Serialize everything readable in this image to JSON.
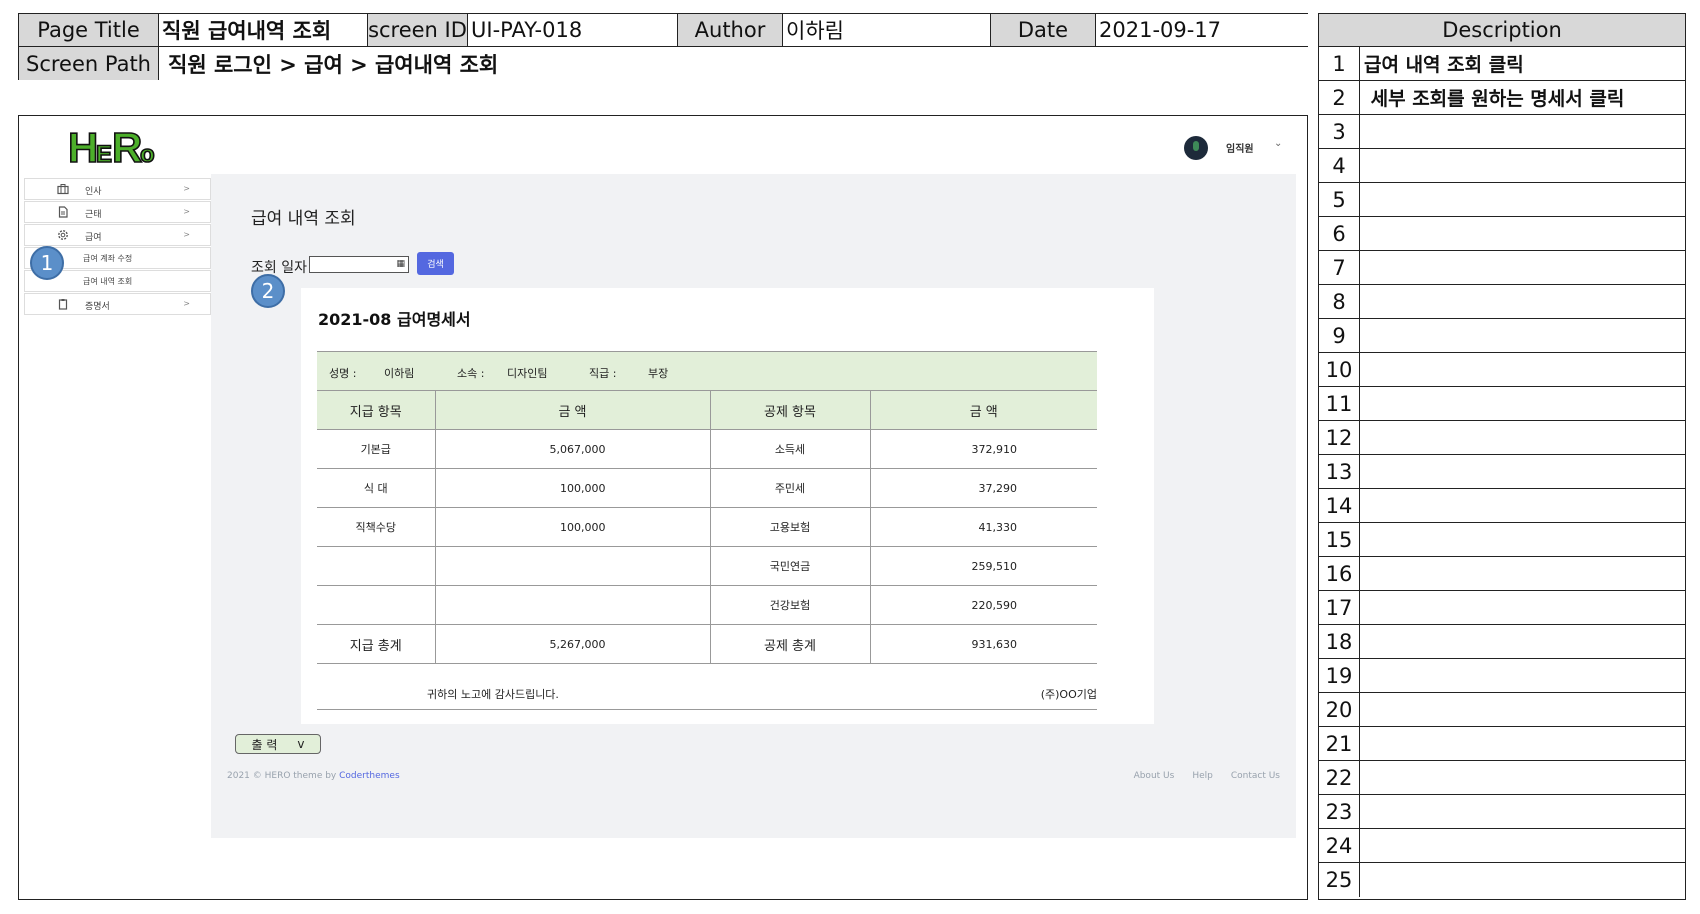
{
  "header": {
    "page_title_label": "Page Title",
    "page_title": "직원 급여내역 조회",
    "screen_id_label": "screen ID",
    "screen_id": "UI-PAY-018",
    "author_label": "Author",
    "author": "이하림",
    "date_label": "Date",
    "date": "2021-09-17",
    "screen_path_label": "Screen Path",
    "screen_path": "직원 로그인 > 급여 > 급여내역 조회"
  },
  "description": {
    "title": "Description",
    "rows": [
      {
        "num": "1",
        "text": "급여 내역 조회 클릭"
      },
      {
        "num": "2",
        "text": " 세부 조회를 원하는 명세서 클릭"
      },
      {
        "num": "3",
        "text": ""
      },
      {
        "num": "4",
        "text": ""
      },
      {
        "num": "5",
        "text": ""
      },
      {
        "num": "6",
        "text": ""
      },
      {
        "num": "7",
        "text": ""
      },
      {
        "num": "8",
        "text": ""
      },
      {
        "num": "9",
        "text": ""
      },
      {
        "num": "10",
        "text": ""
      },
      {
        "num": "11",
        "text": ""
      },
      {
        "num": "12",
        "text": ""
      },
      {
        "num": "13",
        "text": ""
      },
      {
        "num": "14",
        "text": ""
      },
      {
        "num": "15",
        "text": ""
      },
      {
        "num": "16",
        "text": ""
      },
      {
        "num": "17",
        "text": ""
      },
      {
        "num": "18",
        "text": ""
      },
      {
        "num": "19",
        "text": ""
      },
      {
        "num": "20",
        "text": ""
      },
      {
        "num": "21",
        "text": ""
      },
      {
        "num": "22",
        "text": ""
      },
      {
        "num": "23",
        "text": ""
      },
      {
        "num": "24",
        "text": ""
      },
      {
        "num": "25",
        "text": ""
      }
    ]
  },
  "app": {
    "logo_text": "HeRo",
    "user_name": "임직원",
    "user_caret": "⌄",
    "sidebar": [
      {
        "label": "인사",
        "arrow": ">",
        "icon": "briefcase-icon"
      },
      {
        "label": "근태",
        "arrow": ">",
        "icon": "document-icon"
      },
      {
        "label": "급여",
        "arrow": ">",
        "icon": "gear-icon"
      },
      {
        "label": "급여 계좌 수정"
      },
      {
        "label": "급여 내역 조회"
      },
      {
        "label": "증명서",
        "arrow": ">",
        "icon": "clipboard-icon"
      }
    ],
    "page_heading": "급여 내역 조회",
    "query_label": "조회 일자",
    "query_value": "",
    "calendar_glyph": "▦",
    "search_button": "검색",
    "payslip": {
      "title": "2021-08 급여명세서",
      "name_label": "성명 :",
      "name": "이하림",
      "dept_label": "소속 :",
      "dept": "디자인팀",
      "rank_label": "직급 :",
      "rank": "부장",
      "columns": [
        "지급 항목",
        "금 액",
        "공제 항목",
        "금 액"
      ],
      "rows": [
        [
          "기본급",
          "5,067,000",
          "소득세",
          "372,910"
        ],
        [
          "식 대",
          "100,000",
          "주민세",
          "37,290"
        ],
        [
          "직책수당",
          "100,000",
          "고용보험",
          "41,330"
        ],
        [
          "",
          "",
          "국민연금",
          "259,510"
        ],
        [
          "",
          "",
          "건강보험",
          "220,590"
        ]
      ],
      "total": [
        "지급 총계",
        "5,267,000",
        "공제 총계",
        "931,630"
      ],
      "thanks": "귀하의 노고에 감사드립니다.",
      "company": "(주)OO기업"
    },
    "print_button": "출 력",
    "print_caret": "v",
    "footer": {
      "copyright": "2021 © HERO theme by ",
      "copyright_brand": "Coderthemes",
      "links": [
        "About Us",
        "Help",
        "Contact Us"
      ]
    },
    "badges": [
      "1",
      "2"
    ]
  },
  "colors": {
    "accent": "#5468e0",
    "table_header": "#e2efd9",
    "badge": "#5b8fc9",
    "logo_green": "#4caf2a"
  }
}
